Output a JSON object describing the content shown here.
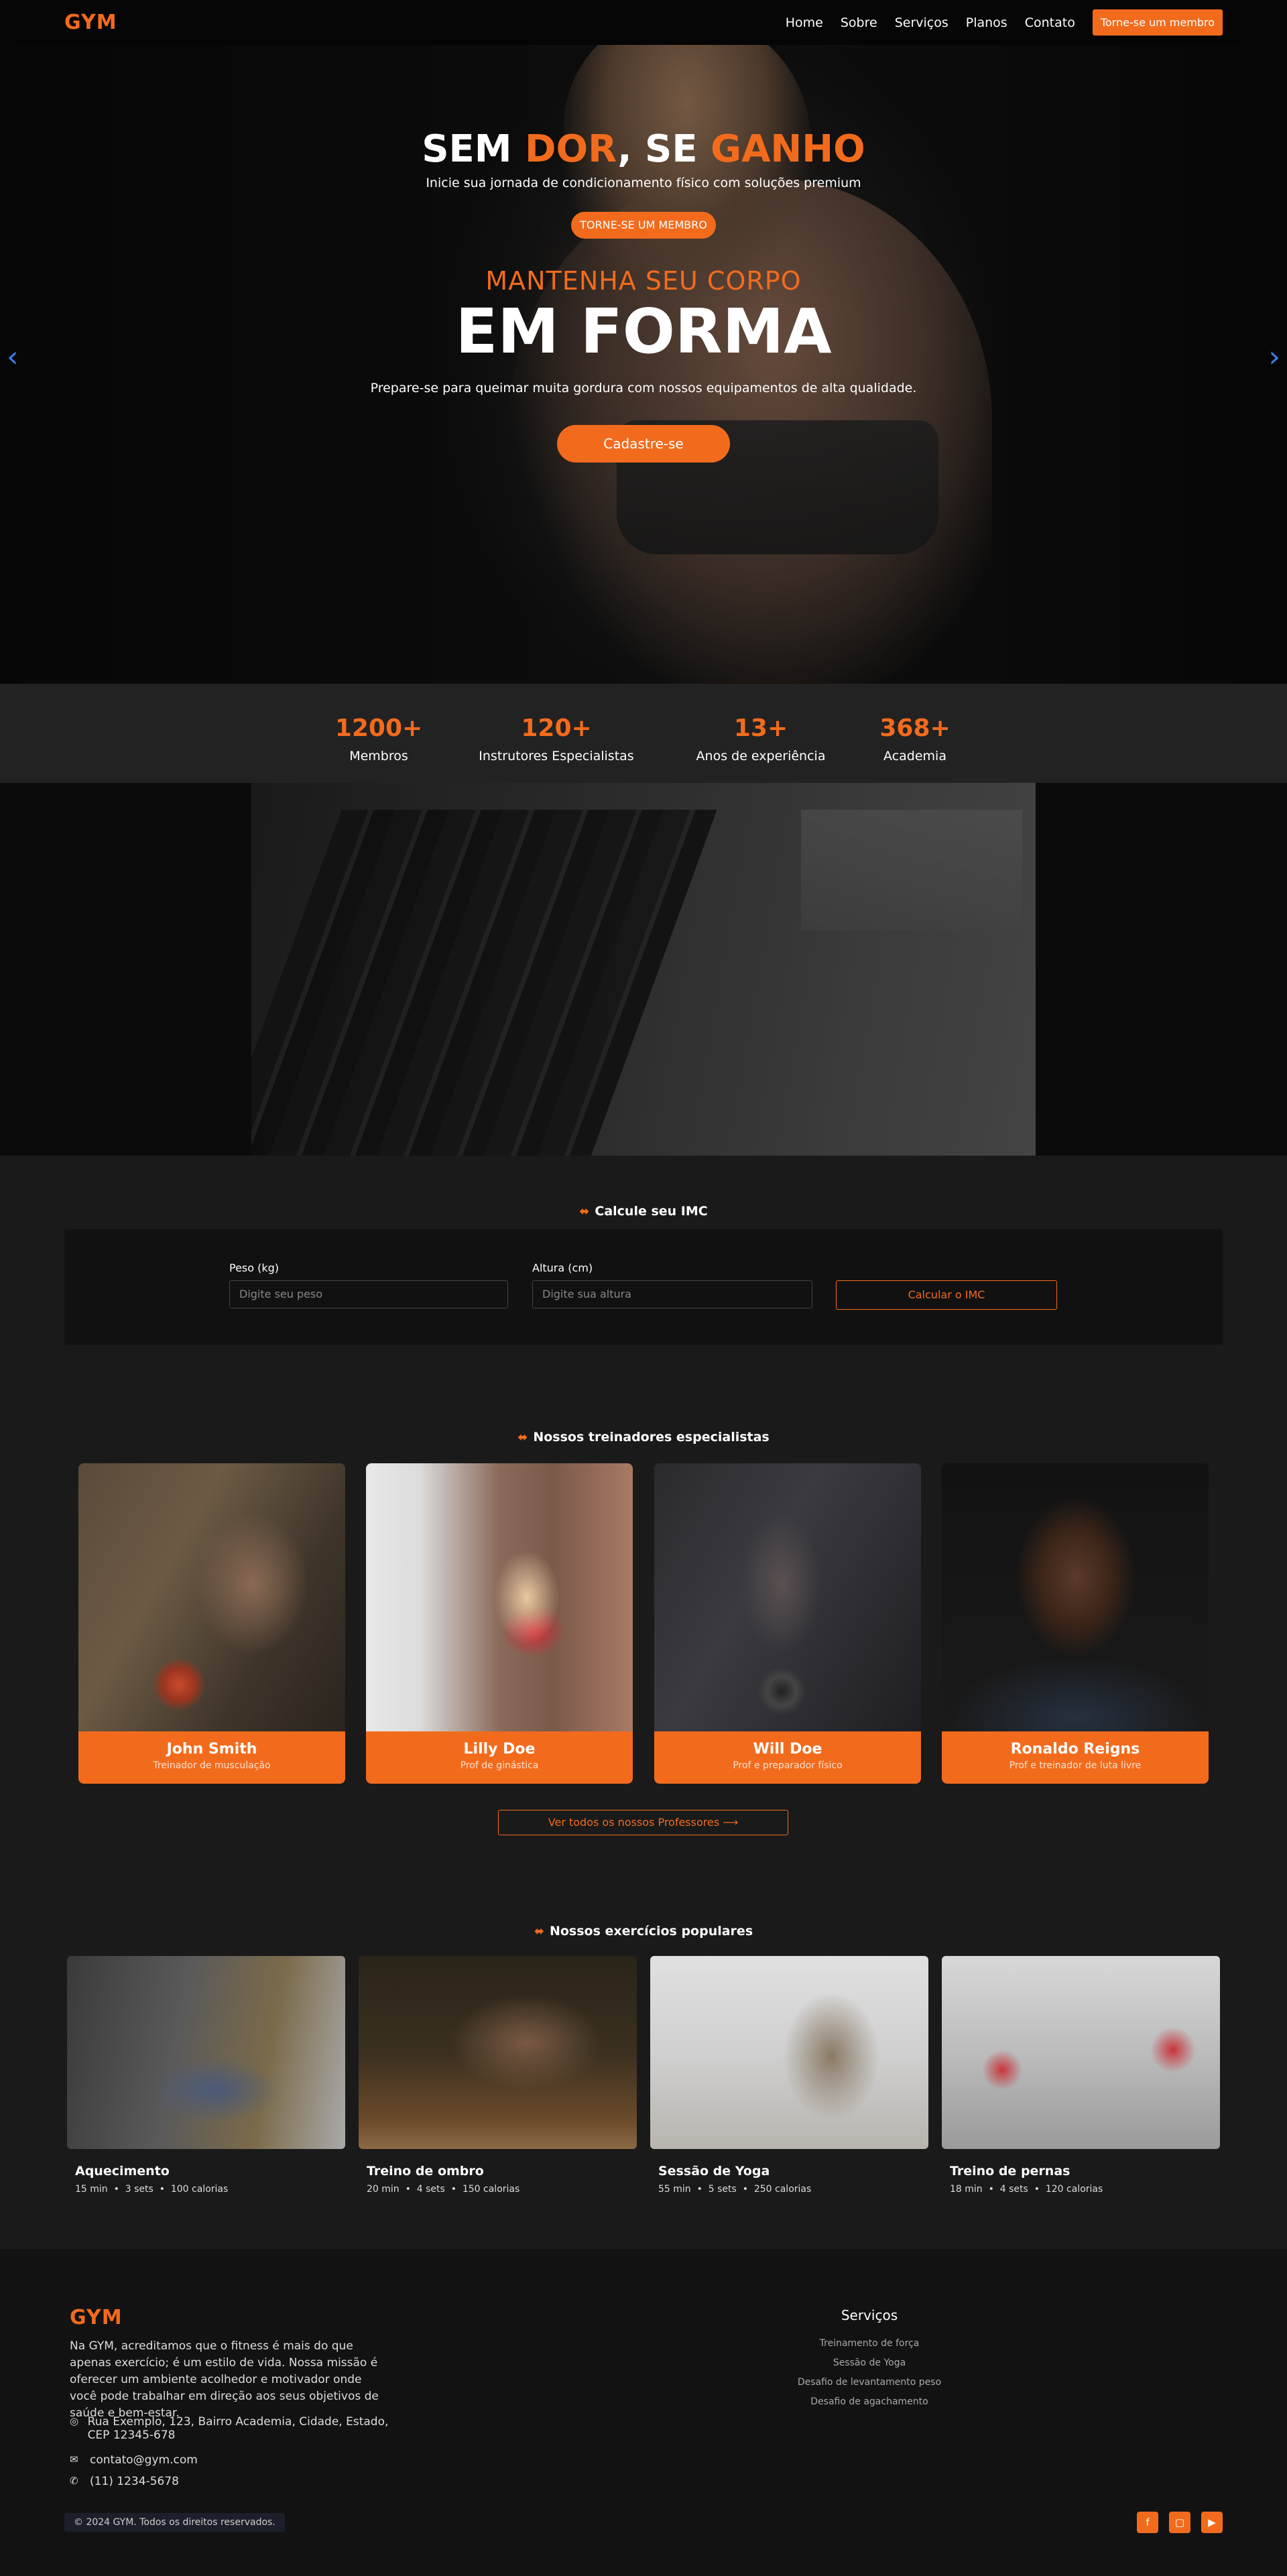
{
  "nav": {
    "logo": "GYM",
    "links": [
      "Home",
      "Sobre",
      "Serviços",
      "Planos",
      "Contato"
    ],
    "cta": "Torne-se um membro"
  },
  "hero": {
    "subtitle": "MANTENHA SEU CORPO",
    "title": "EM FORMA",
    "description": "Prepare-se para queimar muita gordura com nossos equipamentos de alta qualidade.",
    "button": "Cadastre-se",
    "prev_icon": "chevron-left-icon",
    "next_icon": "chevron-right-icon"
  },
  "stats": [
    {
      "value": "1200+",
      "label": "Membros"
    },
    {
      "value": "120+",
      "label": "Instrutores Especialistas"
    },
    {
      "value": "13+",
      "label": "Anos de experiência"
    },
    {
      "value": "368+",
      "label": "Academia"
    }
  ],
  "gain": {
    "title_1": "SEM ",
    "title_2": "DOR",
    "title_3": ", SE ",
    "title_4": "GANHO",
    "subtitle": "Inicie sua jornada de condicionamento físico com soluções premium",
    "button": "TORNE-SE UM MEMBRO"
  },
  "imc": {
    "title": "Calcule seu IMC",
    "weight_label": "Peso (kg)",
    "weight_placeholder": "Digite seu peso",
    "height_label": "Altura (cm)",
    "height_placeholder": "Digite sua altura",
    "button": "Calcular o IMC"
  },
  "trainers": {
    "title": "Nossos treinadores especialistas",
    "items": [
      {
        "name": "John Smith",
        "role": "Treinador de musculação"
      },
      {
        "name": "Lilly Doe",
        "role": "Prof de ginástica"
      },
      {
        "name": "Will Doe",
        "role": "Prof e preparador físico"
      },
      {
        "name": "Ronaldo Reigns",
        "role": "Prof e treinador de luta livre"
      }
    ],
    "all_button": "Ver todos os nossos Professores ⟶"
  },
  "exercises": {
    "title": "Nossos exercícios populares",
    "items": [
      {
        "title": "Aquecimento",
        "time": "15 min",
        "sets": "3 sets",
        "cal": "100 calorias"
      },
      {
        "title": "Treino de ombro",
        "time": "20 min",
        "sets": "4 sets",
        "cal": "150 calorias"
      },
      {
        "title": "Sessão de Yoga",
        "time": "55 min",
        "sets": "5 sets",
        "cal": "250 calorias"
      },
      {
        "title": "Treino de pernas",
        "time": "18 min",
        "sets": "4 sets",
        "cal": "120 calorias"
      }
    ]
  },
  "footer": {
    "logo": "GYM",
    "description": "Na GYM, acreditamos que o fitness é mais do que apenas exercício; é um estilo de vida. Nossa missão é oferecer um ambiente acolhedor e motivador onde você pode trabalhar em direção aos seus objetivos de saúde e bem-estar.",
    "address": "Rua Exemplo, 123, Bairro Academia, Cidade, Estado, CEP 12345-678",
    "email": "contato@gym.com",
    "phone": "(11) 1234-5678",
    "services_title": "Serviços",
    "services": [
      "Treinamento de força",
      "Sessão de Yoga",
      "Desafio de levantamento peso",
      "Desafio de agachamento"
    ],
    "copyright": "© 2024 GYM. Todos os direitos reservados.",
    "social_icons": [
      "facebook-icon",
      "instagram-icon",
      "youtube-icon"
    ]
  },
  "colors": {
    "accent": "#f26b1d",
    "background": "#1a1a1a",
    "nav": "#050505"
  }
}
